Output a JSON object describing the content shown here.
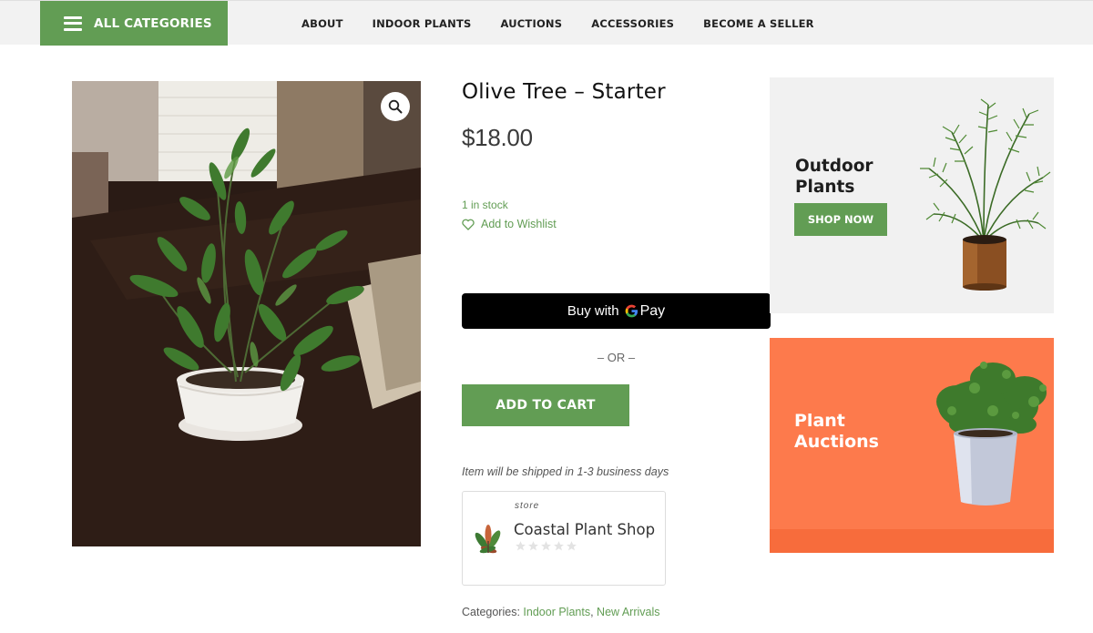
{
  "nav": {
    "all_categories": "ALL CATEGORIES",
    "links": [
      "ABOUT",
      "INDOOR PLANTS",
      "AUCTIONS",
      "ACCESSORIES",
      "BECOME A SELLER"
    ]
  },
  "product": {
    "title": "Olive Tree – Starter",
    "price": "$18.00",
    "stock": "1 in stock",
    "wishlist_label": "Add to Wishlist",
    "gpay_label": "Buy with",
    "gpay_brand": "Pay",
    "or_text": "– OR –",
    "add_to_cart": "ADD TO CART",
    "shipping_note": "Item will be shipped in 1-3 business days",
    "image_icon": "olive-plant-photo"
  },
  "store": {
    "kicker": "store",
    "name": "Coastal Plant Shop",
    "rating": 0,
    "max_rating": 5
  },
  "categories": {
    "label": "Categories:",
    "items": [
      "Indoor Plants",
      "New Arrivals"
    ],
    "separator": ", "
  },
  "banners": {
    "outdoor": {
      "line1": "Outdoor",
      "line2": "Plants",
      "cta": "SHOP NOW"
    },
    "auctions": {
      "line1": "Plant",
      "line2": "Auctions"
    }
  },
  "colors": {
    "accent": "#629d54",
    "nav_bg": "#f2f2f2",
    "auction_bg": "#fd7a4c",
    "gpay_bg": "#000000"
  }
}
